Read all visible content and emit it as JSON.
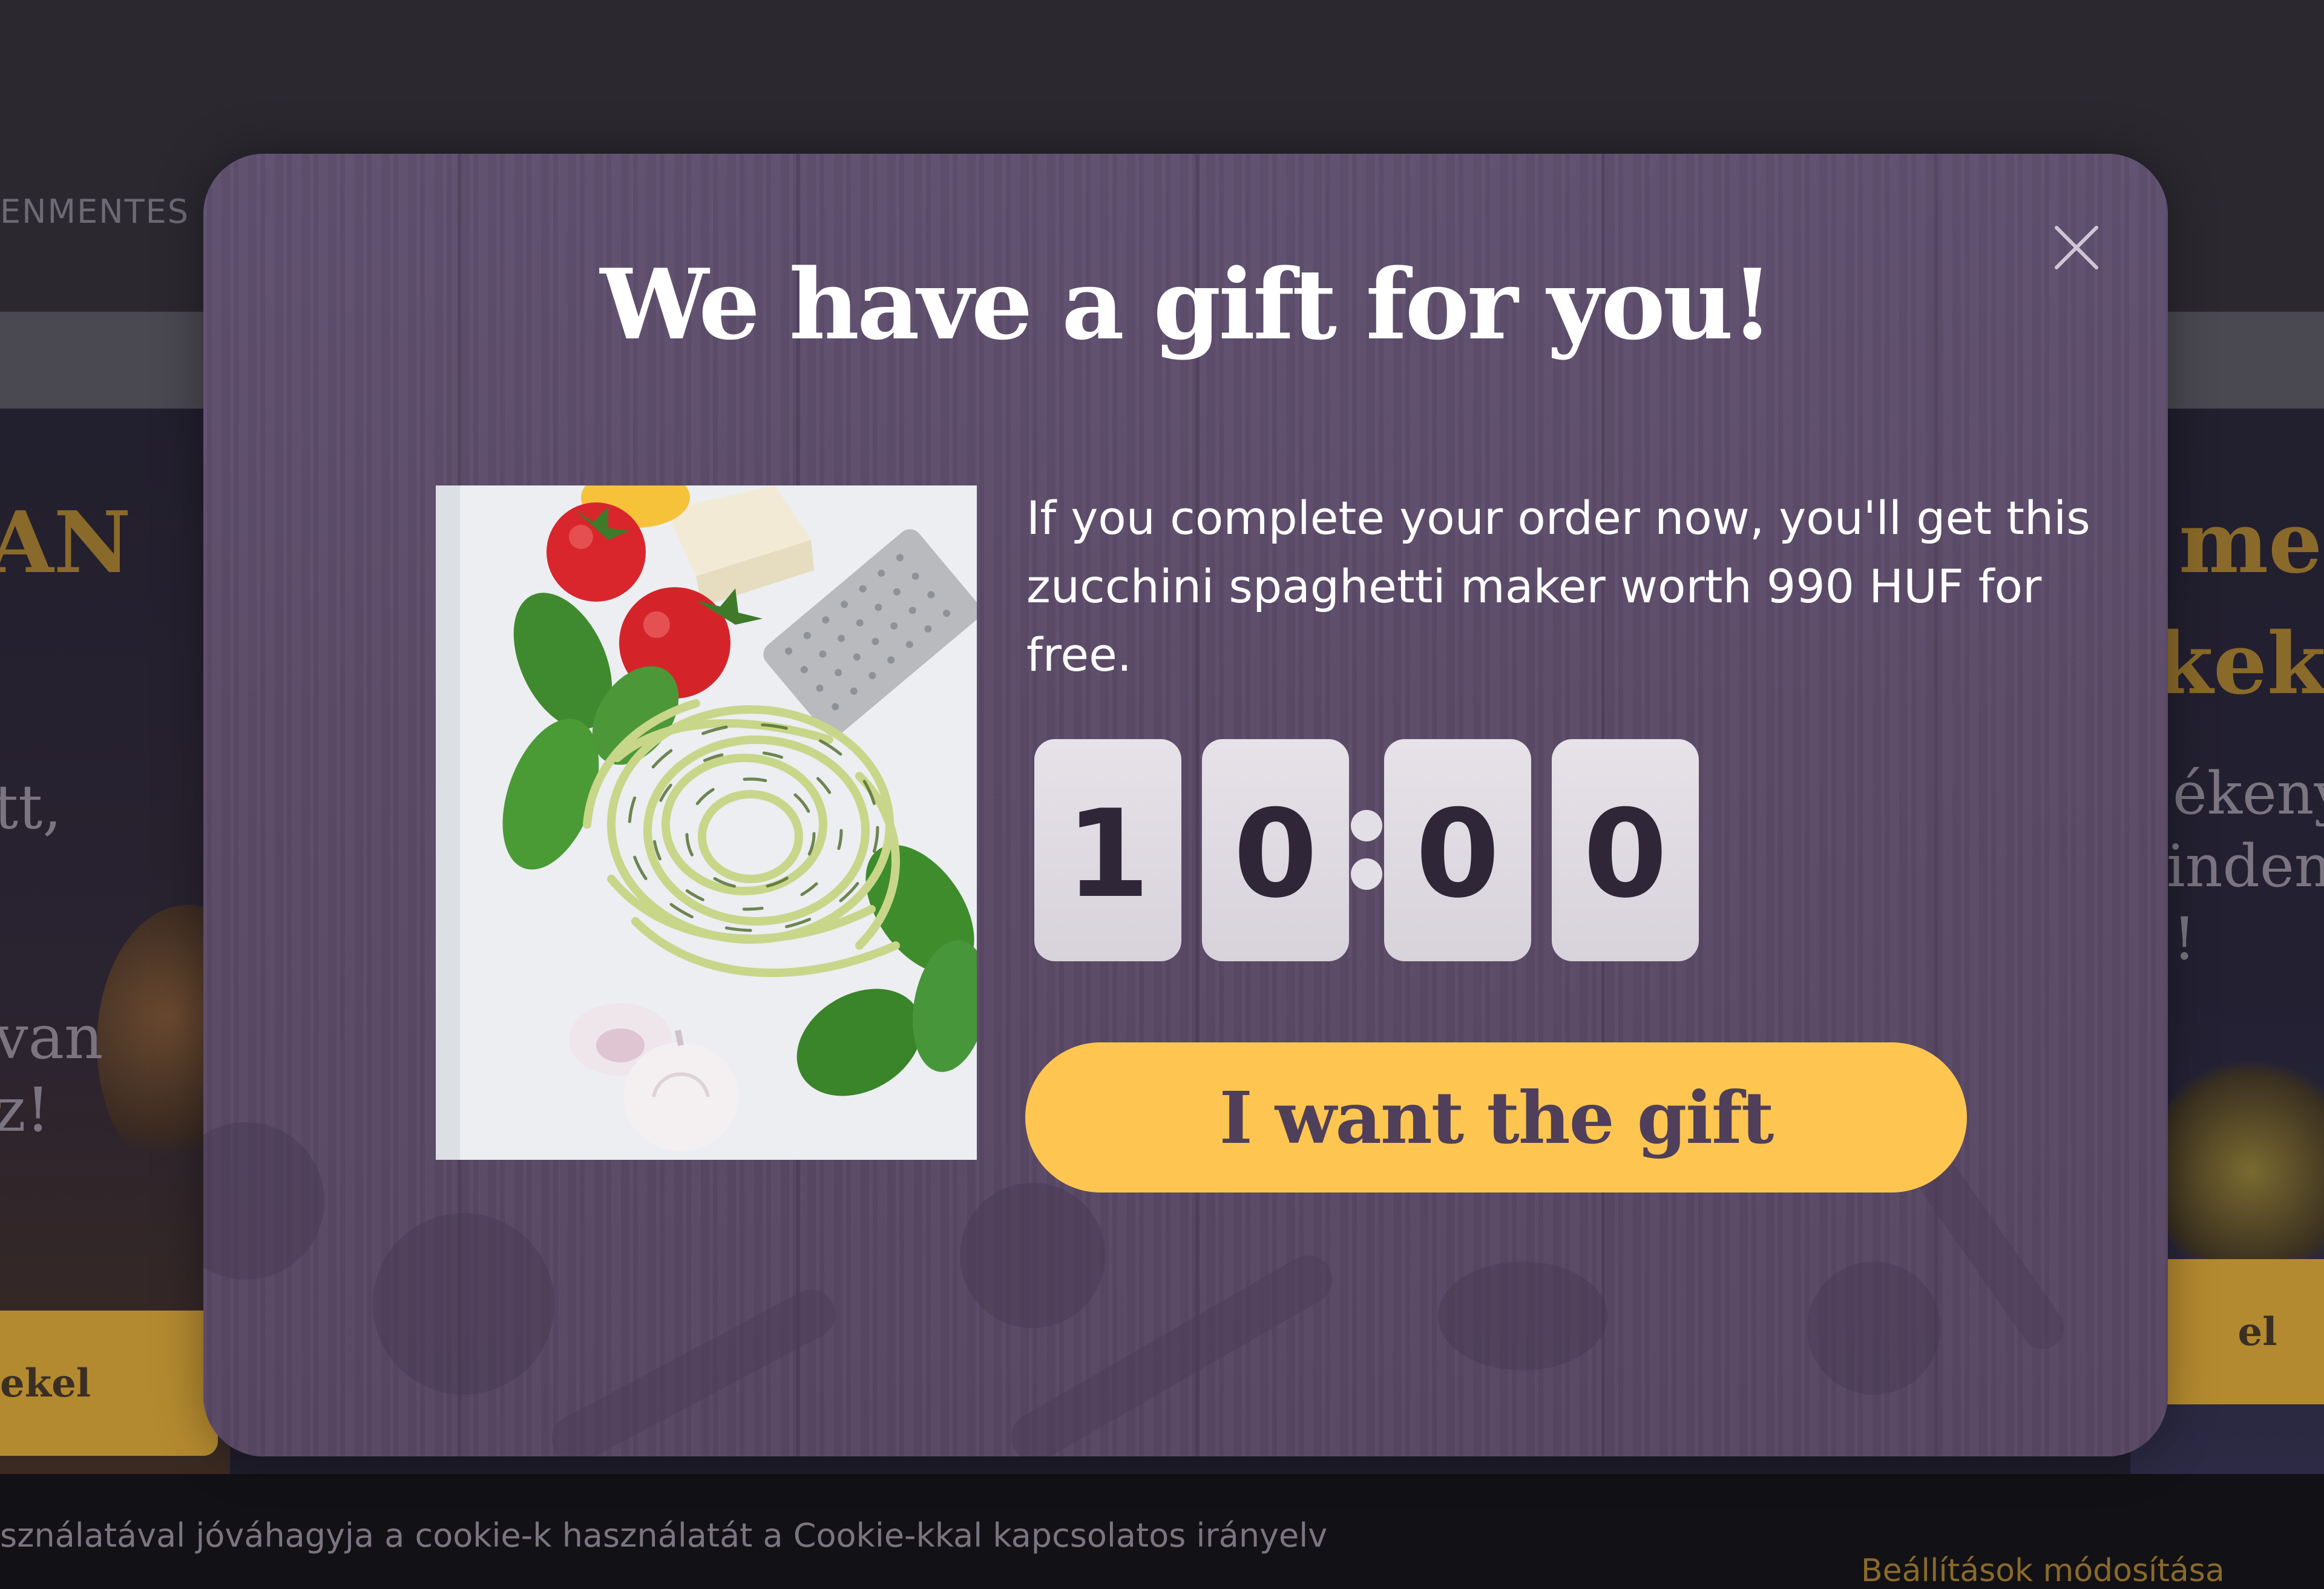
{
  "background_page": {
    "nav_partial": "ENMENTES",
    "hero_left_heading": "AN",
    "hero_left_lines": [
      "tt,",
      "van",
      "z!"
    ],
    "hero_left_button": "ekel",
    "hero_right_heading": [
      "men",
      "kek"
    ],
    "hero_right_lines": [
      "ékeny",
      "inden",
      "!"
    ],
    "hero_right_button": "el",
    "cookie_text": "sználatával jóváhagyja a cookie-k használatát a Cookie-kkal kapcsolatos irányelv",
    "cookie_settings_link": "Beállítások módosítása"
  },
  "popup": {
    "title": "We have a gift for you!",
    "description": "If you complete your order now, you'll get this zucchini spaghetti maker worth 990 HUF for free.",
    "countdown": {
      "minutes_tens": "1",
      "minutes_ones": "0",
      "separator": ":",
      "seconds_tens": "0",
      "seconds_ones": "0"
    },
    "cta_label": "I want the gift",
    "image_subject": "zucchini-spaghetti-image",
    "colors": {
      "overlay": "#5d4c69",
      "cta": "#fec651",
      "cta_text": "#4f3f5a",
      "digit_bg": "#e0dce3",
      "digit_text": "#2f2637"
    }
  }
}
